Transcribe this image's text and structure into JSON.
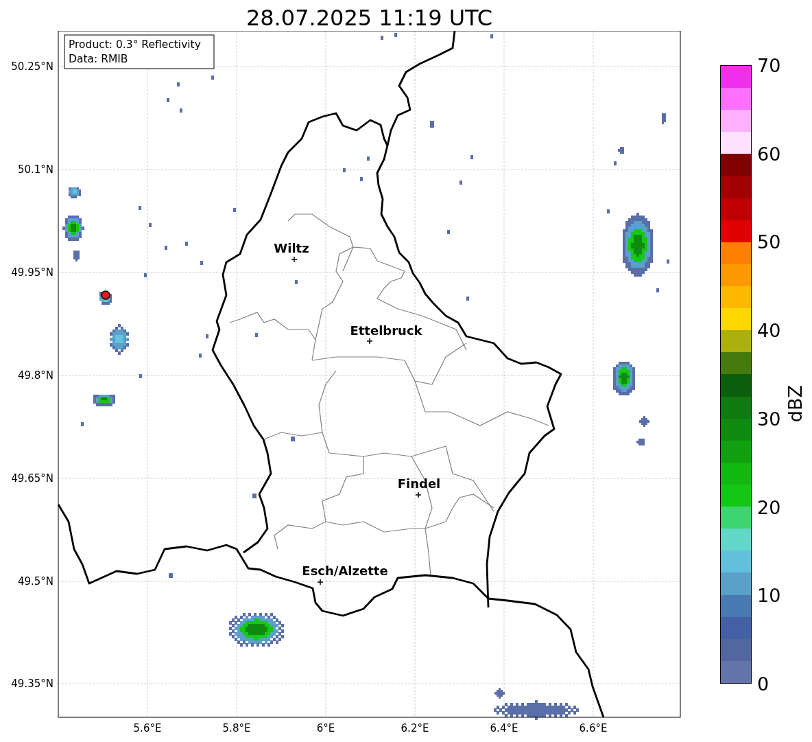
{
  "title": "28.07.2025 11:19 UTC",
  "info_box": [
    "Product: 0.3° Reflectivity",
    "Data: RMIB"
  ],
  "map": {
    "lat_ticks": [
      "50.25°N",
      "50.1°N",
      "49.95°N",
      "49.8°N",
      "49.65°N",
      "49.5°N",
      "49.35°N"
    ],
    "lon_ticks": [
      "5.6°E",
      "5.8°E",
      "6°E",
      "6.2°E",
      "6.4°E",
      "6.6°E"
    ],
    "cities": [
      {
        "name": "Wiltz"
      },
      {
        "name": "Ettelbruck"
      },
      {
        "name": "Findel"
      },
      {
        "name": "Esch/Alzette"
      }
    ]
  },
  "colorbar": {
    "label": "dBZ",
    "ticks": [
      "70",
      "60",
      "50",
      "40",
      "30",
      "20",
      "10",
      "0"
    ],
    "bands": [
      {
        "color": "#6274a8"
      },
      {
        "color": "#5266a0"
      },
      {
        "color": "#4460a5"
      },
      {
        "color": "#4a7ab3"
      },
      {
        "color": "#5aa0c8"
      },
      {
        "color": "#62c0dc"
      },
      {
        "color": "#64d8c8"
      },
      {
        "color": "#3dd56f"
      },
      {
        "color": "#12c812"
      },
      {
        "color": "#10b810"
      },
      {
        "color": "#10a010"
      },
      {
        "color": "#0f8c0f"
      },
      {
        "color": "#0f7a10"
      },
      {
        "color": "#0b5e0b"
      },
      {
        "color": "#467a0c"
      },
      {
        "color": "#aab00c"
      },
      {
        "color": "#ffd700"
      },
      {
        "color": "#ffb800"
      },
      {
        "color": "#ff9900"
      },
      {
        "color": "#ff7f00"
      },
      {
        "color": "#e00000"
      },
      {
        "color": "#c00000"
      },
      {
        "color": "#a00000"
      },
      {
        "color": "#800000"
      },
      {
        "color": "#ffe0ff"
      },
      {
        "color": "#ffb0ff"
      },
      {
        "color": "#ff70ff"
      },
      {
        "color": "#ee30ee"
      }
    ]
  }
}
